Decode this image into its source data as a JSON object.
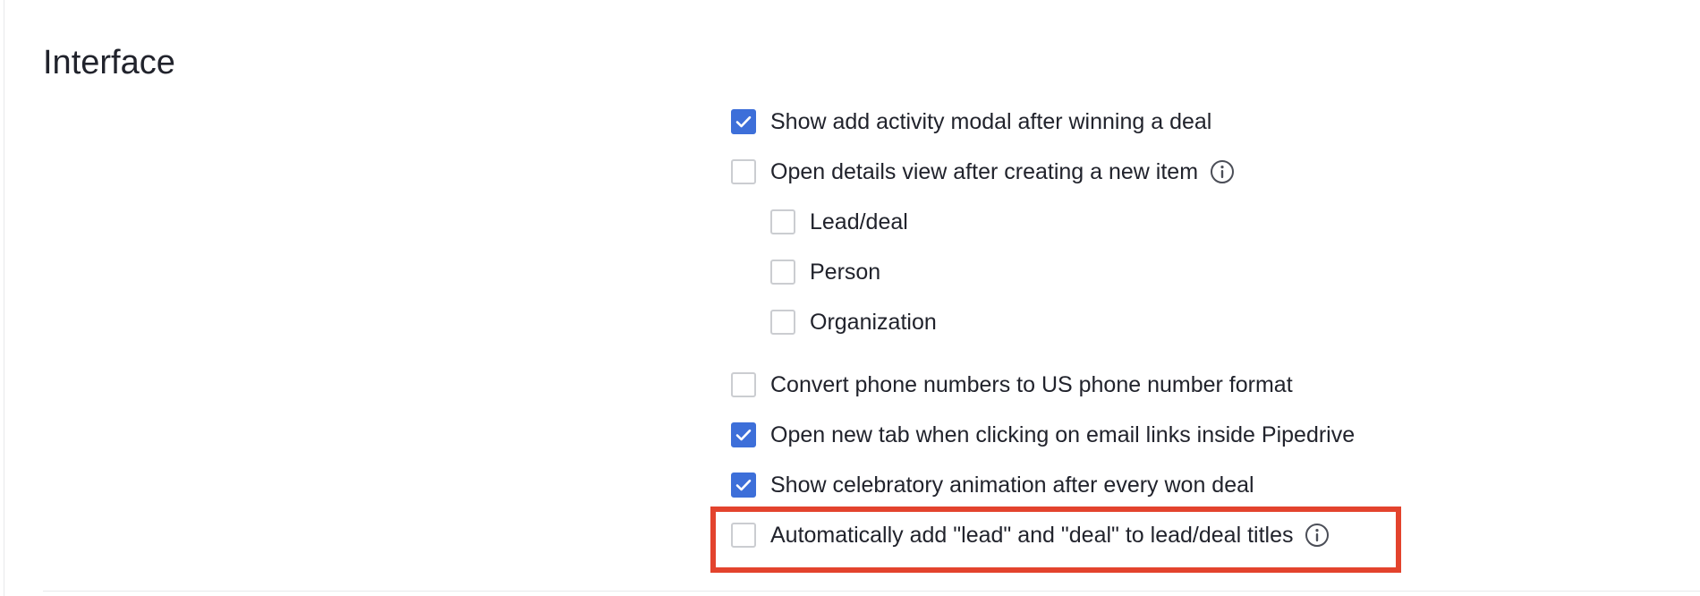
{
  "section": {
    "title": "Interface"
  },
  "options": [
    {
      "label": "Show add activity modal after winning a deal",
      "checked": true,
      "info": false
    },
    {
      "label": "Open details view after creating a new item",
      "checked": false,
      "info": true
    },
    {
      "label": "Lead/deal",
      "checked": false,
      "info": false
    },
    {
      "label": "Person",
      "checked": false,
      "info": false
    },
    {
      "label": "Organization",
      "checked": false,
      "info": false
    },
    {
      "label": "Convert phone numbers to US phone number format",
      "checked": false,
      "info": false
    },
    {
      "label": "Open new tab when clicking on email links inside Pipedrive",
      "checked": true,
      "info": false
    },
    {
      "label": "Show celebratory animation after every won deal",
      "checked": true,
      "info": false
    },
    {
      "label": "Automatically add \"lead\" and \"deal\" to lead/deal titles",
      "checked": false,
      "info": true
    }
  ],
  "colors": {
    "checkbox_checked": "#3d6fd9",
    "checkbox_border": "#cbcdd1",
    "highlight_box": "#e3432d",
    "text": "#21232c"
  },
  "icons": {
    "check": "checkmark-icon",
    "info": "info-circle-icon"
  }
}
